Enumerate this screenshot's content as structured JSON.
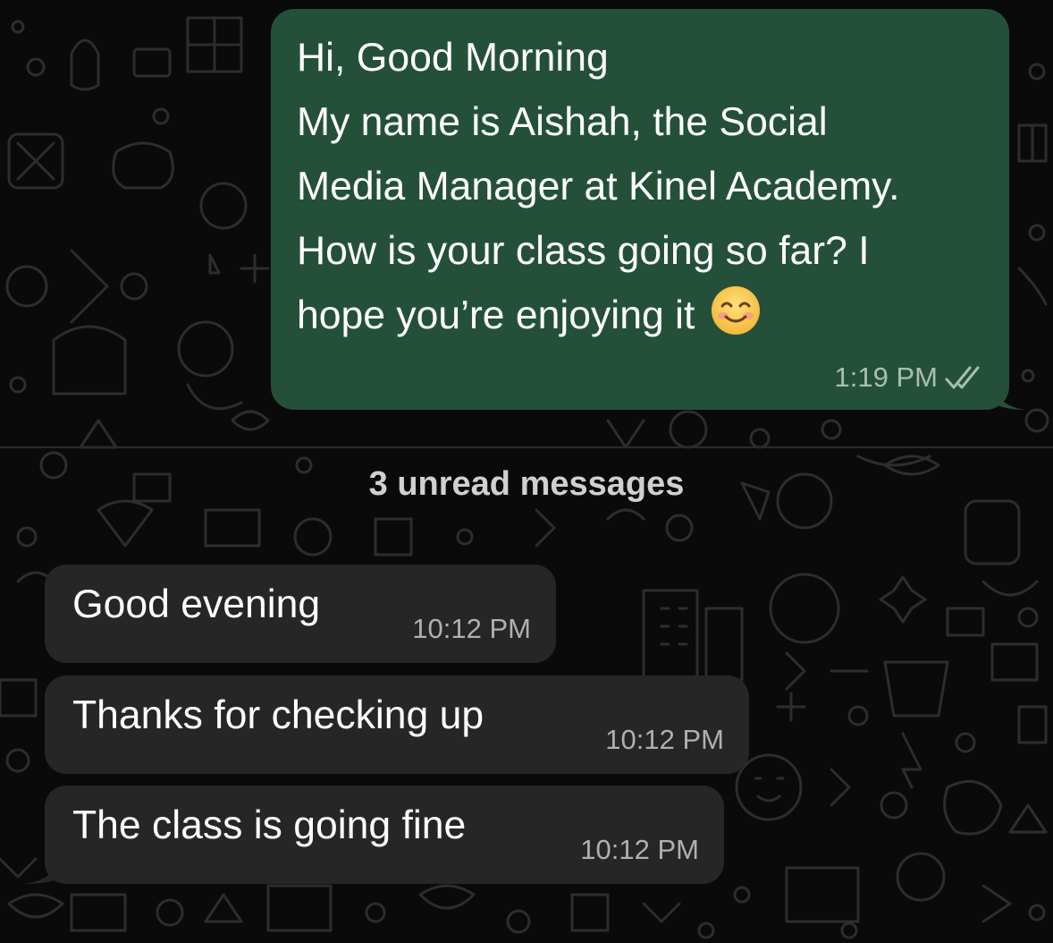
{
  "outgoing": {
    "lines": [
      "Hi, Good Morning",
      "My name is Aishah, the Social",
      "Media Manager at Kinel Academy.",
      "How is your class going so far? I",
      "hope you’re enjoying it"
    ],
    "emoji": "smiling-face-emoji",
    "time": "1:19 PM",
    "status_icon": "double-check-icon",
    "bubble_color": "#24503a"
  },
  "unread_label": "3 unread messages",
  "incoming": [
    {
      "text": "Good evening",
      "time": "10:12 PM"
    },
    {
      "text": "Thanks for checking up",
      "time": "10:12 PM"
    },
    {
      "text": "The class is going fine",
      "time": "10:12 PM"
    }
  ],
  "colors": {
    "background": "#0a0a0a",
    "incoming_bubble": "#262626",
    "doodle": "#2f2f2f"
  }
}
